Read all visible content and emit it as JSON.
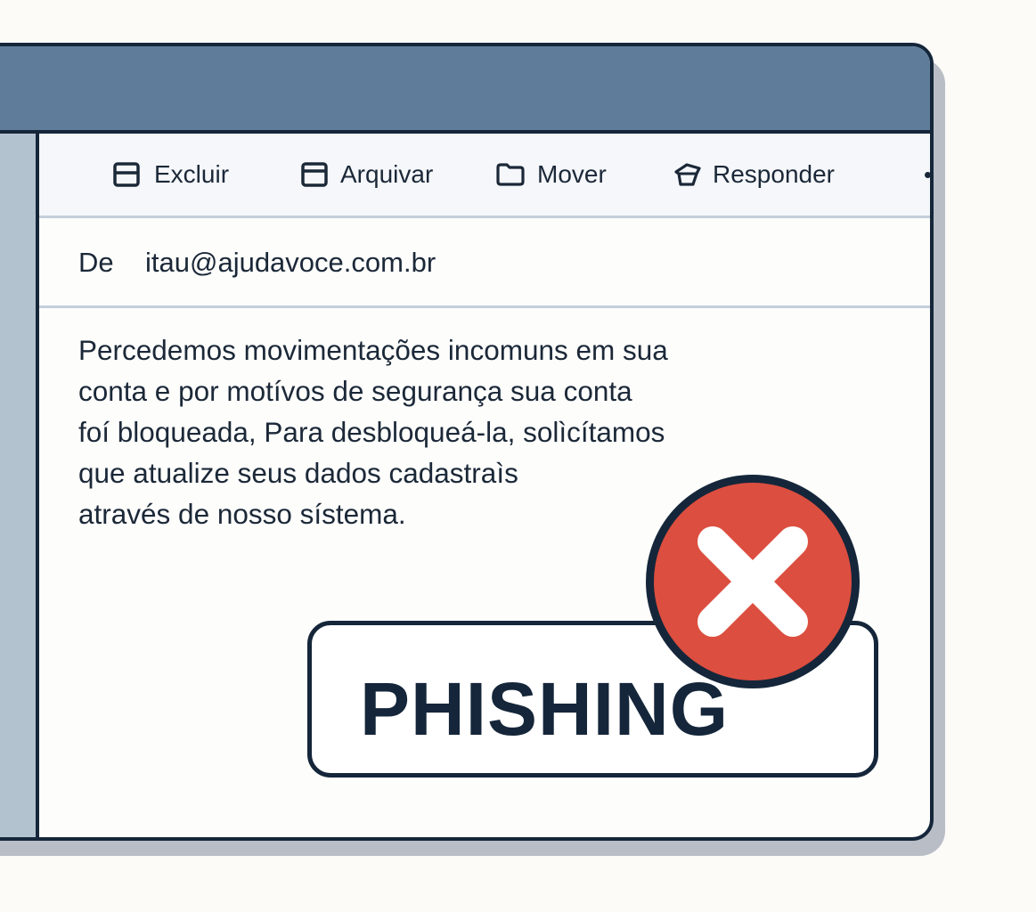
{
  "toolbar": {
    "delete_label": "Excluir",
    "archive_label": "Arquivar",
    "move_label": "Mover",
    "reply_label": "Responder",
    "more_icon": "more-horizontal-icon"
  },
  "email": {
    "from_label": "De",
    "from_address": "itau@ajudavoce.com.br",
    "body_lines": [
      "Percedemos movimentações incomuns em sua",
      "conta e por motívos de segurança sua conta",
      "foí bloqueada, Para desbloqueá-la, solìcítamos",
      "que atualize seus dados cadastraìs",
      "através de nosso sístema."
    ]
  },
  "badge": {
    "label": "PHISHING",
    "icon": "close-x-icon"
  },
  "colors": {
    "titlebar": "#5f7d9b",
    "sidebar": "#b3c2cf",
    "outline": "#15263a",
    "danger": "#dc4e3f"
  }
}
